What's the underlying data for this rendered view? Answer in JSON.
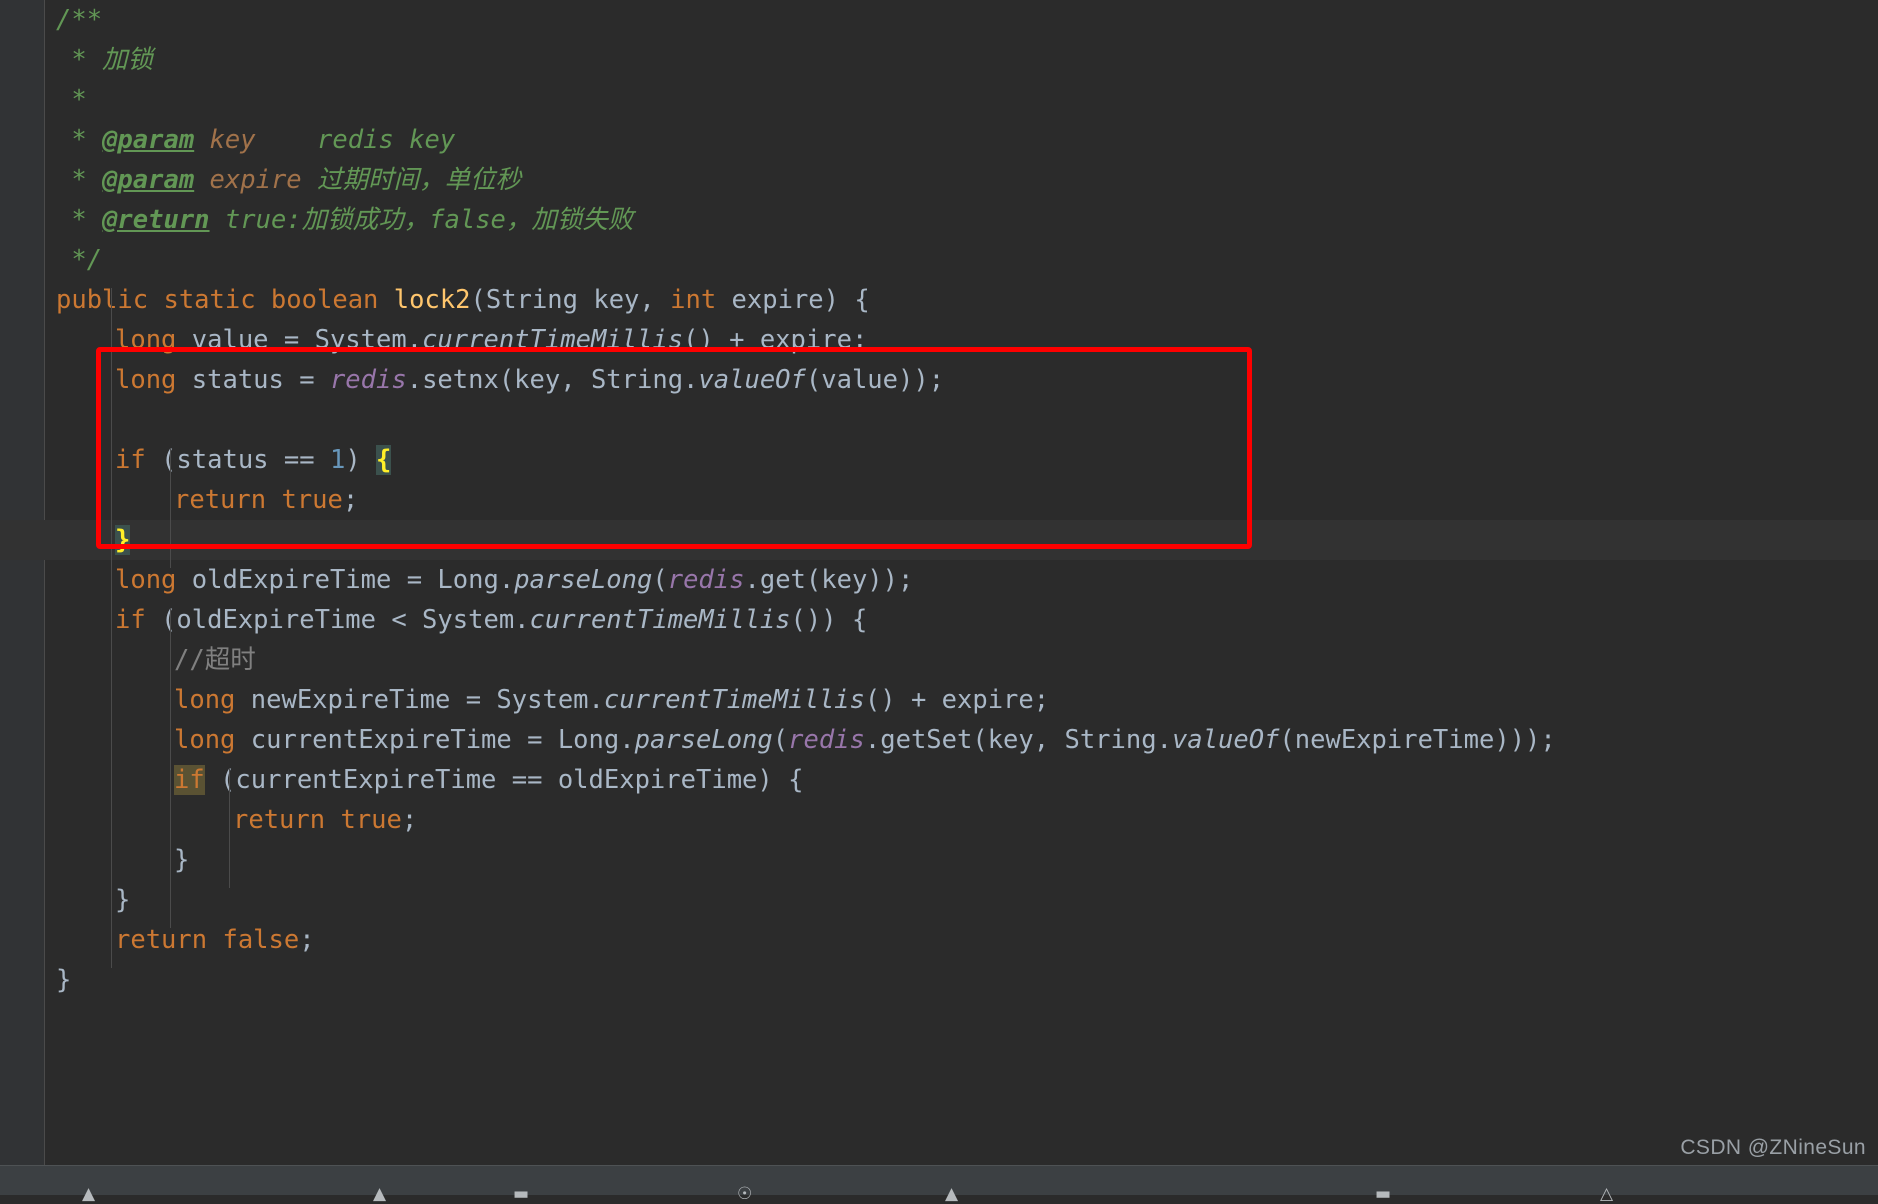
{
  "editor": {
    "theme": "darcula",
    "background_color": "#2b2b2b",
    "current_line_color": "#323232",
    "gutter_color": "#313335",
    "language": "Java",
    "colors": {
      "keyword": "#cc7832",
      "identifier": "#a9b7c6",
      "method_name": "#ffc66d",
      "static_call": "#a9b7c6",
      "field": "#9876aa",
      "number": "#6897bb",
      "comment": "#808080",
      "javadoc": "#629755",
      "javadoc_value": "#a1724a",
      "brace_match_bg": "#3b514d",
      "brace_match_fg": "#ffef28",
      "search_highlight_bg": "#5a5233",
      "annotation_red": "#ff0000"
    }
  },
  "annotation": {
    "shape": "rectangle",
    "color": "#ff0000",
    "covers_lines": [
      "long status = redis.setnx(key, String.valueOf(value));",
      "",
      "if (status == 1) {",
      "return true;",
      "}"
    ]
  },
  "code": {
    "lines": [
      {
        "id": "l1",
        "indent": 0,
        "tokens": [
          {
            "t": "/**",
            "c": "doc"
          }
        ]
      },
      {
        "id": "l2",
        "indent": 0,
        "tokens": [
          {
            "t": " * 加锁",
            "c": "doc"
          }
        ]
      },
      {
        "id": "l3",
        "indent": 0,
        "tokens": [
          {
            "t": " *",
            "c": "doc"
          }
        ]
      },
      {
        "id": "l4",
        "indent": 0,
        "tokens": [
          {
            "t": " * ",
            "c": "doc"
          },
          {
            "t": "@param",
            "c": "doctag"
          },
          {
            "t": " ",
            "c": "doc"
          },
          {
            "t": "key",
            "c": "docval"
          },
          {
            "t": "    redis key",
            "c": "doc"
          }
        ]
      },
      {
        "id": "l5",
        "indent": 0,
        "tokens": [
          {
            "t": " * ",
            "c": "doc"
          },
          {
            "t": "@param",
            "c": "doctag"
          },
          {
            "t": " ",
            "c": "doc"
          },
          {
            "t": "expire",
            "c": "docval"
          },
          {
            "t": " 过期时间，单位秒",
            "c": "doc"
          }
        ]
      },
      {
        "id": "l6",
        "indent": 0,
        "tokens": [
          {
            "t": " * ",
            "c": "doc"
          },
          {
            "t": "@return",
            "c": "doctag"
          },
          {
            "t": " true:加锁成功，false，加锁失败",
            "c": "doc"
          }
        ]
      },
      {
        "id": "l7",
        "indent": 0,
        "tokens": [
          {
            "t": " */",
            "c": "doc"
          }
        ]
      },
      {
        "id": "l8",
        "indent": 0,
        "tokens": [
          {
            "t": "public static boolean ",
            "c": "kw"
          },
          {
            "t": "lock2",
            "c": "mname"
          },
          {
            "t": "(String key, ",
            "c": "ident"
          },
          {
            "t": "int",
            "c": "kw"
          },
          {
            "t": " expire) {",
            "c": "ident"
          }
        ]
      },
      {
        "id": "l9",
        "indent": 1,
        "tokens": [
          {
            "t": "long",
            "c": "kw"
          },
          {
            "t": " value = System.",
            "c": "ident"
          },
          {
            "t": "currentTimeMillis",
            "c": "stat"
          },
          {
            "t": "() + expire;",
            "c": "ident"
          }
        ]
      },
      {
        "id": "l10",
        "indent": 1,
        "tokens": [
          {
            "t": "long",
            "c": "kw"
          },
          {
            "t": " status = ",
            "c": "ident"
          },
          {
            "t": "redis",
            "c": "field"
          },
          {
            "t": ".setnx(key, String.",
            "c": "ident"
          },
          {
            "t": "valueOf",
            "c": "stat"
          },
          {
            "t": "(value));",
            "c": "ident"
          }
        ]
      },
      {
        "id": "l11",
        "indent": 1,
        "tokens": []
      },
      {
        "id": "l12",
        "indent": 1,
        "tokens": [
          {
            "t": "if",
            "c": "kw"
          },
          {
            "t": " (status == ",
            "c": "ident"
          },
          {
            "t": "1",
            "c": "num"
          },
          {
            "t": ") ",
            "c": "ident"
          },
          {
            "t": "{",
            "c": "brace-match"
          }
        ]
      },
      {
        "id": "l13",
        "indent": 2,
        "tokens": [
          {
            "t": "return true",
            "c": "kw"
          },
          {
            "t": ";",
            "c": "ident"
          }
        ]
      },
      {
        "id": "l14",
        "indent": 1,
        "highlight_line": true,
        "tokens": [
          {
            "t": "}",
            "c": "brace-match"
          }
        ]
      },
      {
        "id": "l15",
        "indent": 1,
        "tokens": [
          {
            "t": "long",
            "c": "kw"
          },
          {
            "t": " oldExpireTime = Long.",
            "c": "ident"
          },
          {
            "t": "parseLong",
            "c": "stat"
          },
          {
            "t": "(",
            "c": "ident"
          },
          {
            "t": "redis",
            "c": "field"
          },
          {
            "t": ".get(key));",
            "c": "ident"
          }
        ]
      },
      {
        "id": "l16",
        "indent": 1,
        "tokens": [
          {
            "t": "if",
            "c": "kw"
          },
          {
            "t": " (oldExpireTime < System.",
            "c": "ident"
          },
          {
            "t": "currentTimeMillis",
            "c": "stat"
          },
          {
            "t": "()) {",
            "c": "ident"
          }
        ]
      },
      {
        "id": "l17",
        "indent": 2,
        "tokens": [
          {
            "t": "//超时",
            "c": "cmt"
          }
        ]
      },
      {
        "id": "l18",
        "indent": 2,
        "tokens": [
          {
            "t": "long",
            "c": "kw"
          },
          {
            "t": " newExpireTime = System.",
            "c": "ident"
          },
          {
            "t": "currentTimeMillis",
            "c": "stat"
          },
          {
            "t": "() + expire;",
            "c": "ident"
          }
        ]
      },
      {
        "id": "l19",
        "indent": 2,
        "tokens": [
          {
            "t": "long",
            "c": "kw"
          },
          {
            "t": " currentExpireTime = Long.",
            "c": "ident"
          },
          {
            "t": "parseLong",
            "c": "stat"
          },
          {
            "t": "(",
            "c": "ident"
          },
          {
            "t": "redis",
            "c": "field"
          },
          {
            "t": ".getSet(key, String.",
            "c": "ident"
          },
          {
            "t": "valueOf",
            "c": "stat"
          },
          {
            "t": "(newExpireTime)));",
            "c": "ident"
          }
        ]
      },
      {
        "id": "l20",
        "indent": 2,
        "tokens": [
          {
            "t": "if",
            "c": "kw search-hit"
          },
          {
            "t": " (currentExpireTime == oldExpireTime) {",
            "c": "ident"
          }
        ]
      },
      {
        "id": "l21",
        "indent": 3,
        "tokens": [
          {
            "t": "return true",
            "c": "kw"
          },
          {
            "t": ";",
            "c": "ident"
          }
        ]
      },
      {
        "id": "l22",
        "indent": 2,
        "tokens": [
          {
            "t": "}",
            "c": "ident"
          }
        ]
      },
      {
        "id": "l23",
        "indent": 1,
        "tokens": [
          {
            "t": "}",
            "c": "ident"
          }
        ]
      },
      {
        "id": "l24",
        "indent": 1,
        "tokens": [
          {
            "t": "return false",
            "c": "kw"
          },
          {
            "t": ";",
            "c": "ident"
          }
        ]
      },
      {
        "id": "l25",
        "indent": 0,
        "tokens": [
          {
            "t": "}",
            "c": "ident"
          }
        ]
      }
    ]
  },
  "bottom_bar": {
    "icons": [
      "terminal-icon",
      "info-icon",
      "grid-icon",
      "debug-icon",
      "warning-icon",
      "build-icon",
      "run-icon"
    ]
  },
  "watermark": {
    "text": "CSDN @ZNineSun"
  }
}
